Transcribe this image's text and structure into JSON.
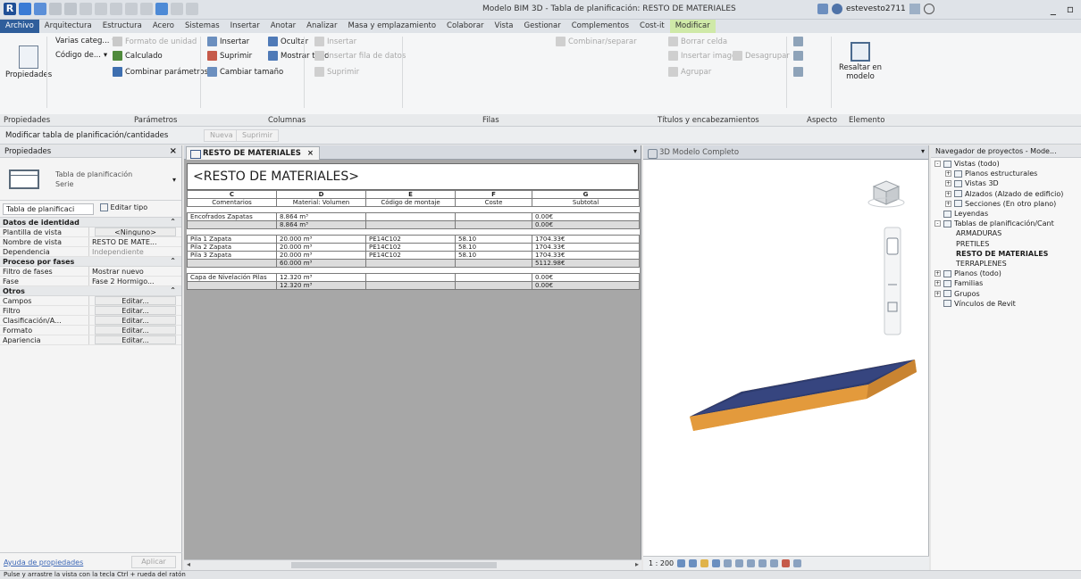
{
  "title_bar": {
    "title": "Modelo BIM 3D - Tabla de planificación: RESTO DE MATERIALES",
    "user": "estevesto2711",
    "app_icon": "revit-logo-icon"
  },
  "ribbon_tabs": [
    "Archivo",
    "Arquitectura",
    "Estructura",
    "Acero",
    "Sistemas",
    "Insertar",
    "Anotar",
    "Analizar",
    "Masa y emplazamiento",
    "Colaborar",
    "Vista",
    "Gestionar",
    "Complementos",
    "Cost-it",
    "Modificar"
  ],
  "ribbon": {
    "properties_btn": "Propiedades",
    "param": {
      "dd1": "Varias categ...",
      "dd2": "Código de...",
      "format_unit": "Formato de unidad",
      "calculated": "Calculado",
      "combine": "Combinar parámetros"
    },
    "columns": {
      "insert": "Insertar",
      "delete": "Suprimir",
      "resize": "Cambiar tamaño",
      "hide": "Ocultar",
      "show_all": "Mostrar todo"
    },
    "rows": {
      "insert": "Insertar",
      "insert_data_row": "Insertar fila de datos",
      "delete": "Suprimir"
    },
    "titles": {
      "merge": "Combinar/separar",
      "insert_image": "Insertar imagen",
      "clear_cell": "Borrar celda",
      "group": "Agrupar",
      "ungroup": "Desagrupar"
    },
    "highlight": "Resaltar en modelo",
    "panels": [
      "Propiedades",
      "Parámetros",
      "Columnas",
      "Filas",
      "Títulos y encabezamientos",
      "Aspecto",
      "Elemento"
    ]
  },
  "context_bar": {
    "label": "Modificar tabla de planificación/cantidades",
    "btn1": "Nueva",
    "btn2": "Suprimir"
  },
  "properties": {
    "header": "Propiedades",
    "type_name_1": "Tabla de planificación",
    "type_name_2": "Serie",
    "selector": "Tabla de planificaci",
    "edit_type": "Editar tipo",
    "groups": [
      {
        "name": "Datos de identidad",
        "rows": [
          {
            "k": "Plantilla de vista",
            "v": "<Ninguno>",
            "style": "btn"
          },
          {
            "k": "Nombre de vista",
            "v": "RESTO DE MATE...",
            "style": ""
          },
          {
            "k": "Dependencia",
            "v": "Independiente",
            "style": "gray"
          }
        ]
      },
      {
        "name": "Proceso por fases",
        "rows": [
          {
            "k": "Filtro de fases",
            "v": "Mostrar nuevo",
            "style": ""
          },
          {
            "k": "Fase",
            "v": "Fase 2 Hormigo...",
            "style": ""
          }
        ]
      },
      {
        "name": "Otros",
        "rows": [
          {
            "k": "Campos",
            "v": "Editar...",
            "style": "btn"
          },
          {
            "k": "Filtro",
            "v": "Editar...",
            "style": "btn"
          },
          {
            "k": "Clasificación/A...",
            "v": "Editar...",
            "style": "btn"
          },
          {
            "k": "Formato",
            "v": "Editar...",
            "style": "btn"
          },
          {
            "k": "Apariencia",
            "v": "Editar...",
            "style": "btn"
          }
        ]
      }
    ],
    "help_link": "Ayuda de propiedades",
    "apply": "Aplicar"
  },
  "schedule": {
    "tab": "RESTO DE MATERIALES",
    "title": "<RESTO DE MATERIALES>",
    "col_letters": [
      "C",
      "D",
      "E",
      "F",
      "G"
    ],
    "col_headers": [
      "Comentarios",
      "Material: Volumen",
      "Código de montaje",
      "Coste",
      "Subtotal"
    ],
    "rows": [
      {
        "type": "gap",
        "cells": [
          "",
          "",
          "",
          "",
          ""
        ]
      },
      {
        "type": "data",
        "cells": [
          "Encofrados Zapatas",
          "8.864 m³",
          "",
          "",
          "0.00€"
        ]
      },
      {
        "type": "tot",
        "cells": [
          "",
          "8.864 m³",
          "",
          "",
          "0.00€"
        ]
      },
      {
        "type": "gap",
        "cells": [
          "",
          "",
          "",
          "",
          ""
        ]
      },
      {
        "type": "data",
        "cells": [
          "Pila 1 Zapata",
          "20.000 m³",
          "PE14C102",
          "58.10",
          "1704.33€"
        ]
      },
      {
        "type": "data",
        "cells": [
          "Pila 2 Zapata",
          "20.000 m³",
          "PE14C102",
          "58.10",
          "1704.33€"
        ]
      },
      {
        "type": "data",
        "cells": [
          "Pila 3 Zapata",
          "20.000 m³",
          "PE14C102",
          "58.10",
          "1704.33€"
        ]
      },
      {
        "type": "tot",
        "cells": [
          "",
          "60.000 m³",
          "",
          "",
          "5112.98€"
        ]
      },
      {
        "type": "gap",
        "cells": [
          "",
          "",
          "",
          "",
          ""
        ]
      },
      {
        "type": "data",
        "cells": [
          "Capa de Nivelación Pilas",
          "12.320 m³",
          "",
          "",
          "0.00€"
        ]
      },
      {
        "type": "tot",
        "cells": [
          "",
          "12.320 m³",
          "",
          "",
          "0.00€"
        ]
      }
    ]
  },
  "view3d": {
    "tab": "3D Modelo Completo",
    "scale": "1 : 200"
  },
  "browser": {
    "header": "Navegador de proyectos - Mode...",
    "nodes": [
      {
        "label": "Vistas (todo)",
        "indent": 0,
        "pm": "-",
        "bold": false
      },
      {
        "label": "Planos estructurales",
        "indent": 1,
        "pm": "+",
        "bold": false
      },
      {
        "label": "Vistas 3D",
        "indent": 1,
        "pm": "+",
        "bold": false
      },
      {
        "label": "Alzados (Alzado de edificio)",
        "indent": 1,
        "pm": "+",
        "bold": false
      },
      {
        "label": "Secciones (En otro plano)",
        "indent": 1,
        "pm": "+",
        "bold": false
      },
      {
        "label": "Leyendas",
        "indent": 0,
        "pm": "",
        "bold": false
      },
      {
        "label": "Tablas de planificación/Cant",
        "indent": 0,
        "pm": "-",
        "bold": false
      },
      {
        "label": "ARMADURAS",
        "indent": 2,
        "pm": "",
        "bold": false
      },
      {
        "label": "PRETILES",
        "indent": 2,
        "pm": "",
        "bold": false
      },
      {
        "label": "RESTO DE MATERIALES",
        "indent": 2,
        "pm": "",
        "bold": true
      },
      {
        "label": "TERRAPLENES",
        "indent": 2,
        "pm": "",
        "bold": false
      },
      {
        "label": "Planos (todo)",
        "indent": 0,
        "pm": "+",
        "bold": false
      },
      {
        "label": "Familias",
        "indent": 0,
        "pm": "+",
        "bold": false
      },
      {
        "label": "Grupos",
        "indent": 0,
        "pm": "+",
        "bold": false
      },
      {
        "label": "Vínculos de Revit",
        "indent": 0,
        "pm": "",
        "bold": false
      }
    ]
  },
  "status": {
    "message": "Pulse y arrastre la vista con la tecla Ctrl + rueda del ratón"
  }
}
